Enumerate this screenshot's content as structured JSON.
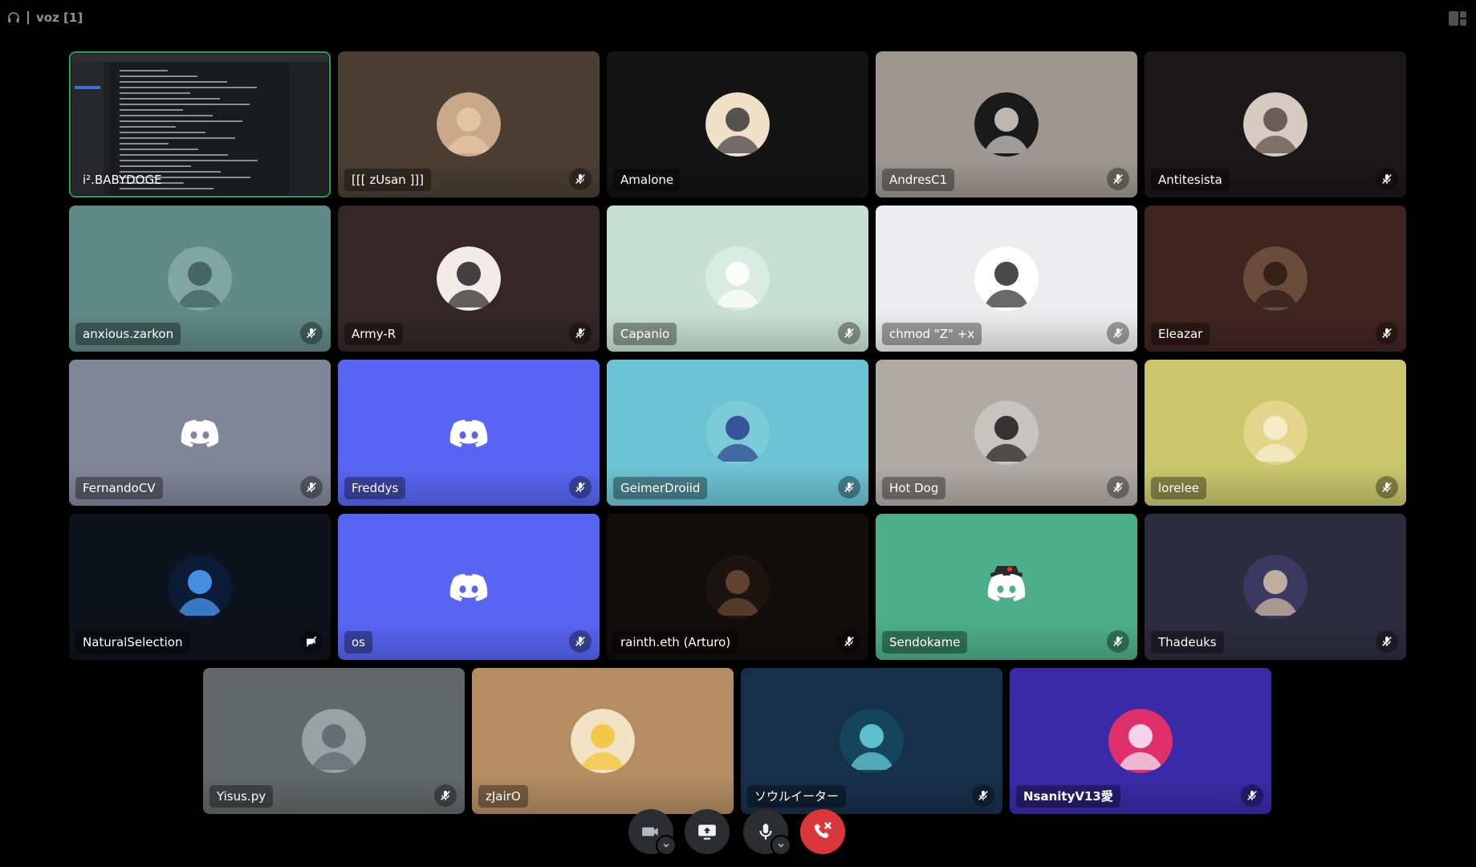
{
  "header": {
    "channel_name": "voz [1]",
    "headset_icon": "headset-icon",
    "layout_icon": "grid-layout-icon"
  },
  "colors": {
    "speaking_ring": "#23a55a",
    "blurple": "#5865f2",
    "danger": "#da373c"
  },
  "participants": [
    {
      "name": "i².BABYDOGE",
      "bg": "#111214",
      "streaming": true,
      "muted": false
    },
    {
      "name": "[[[ zUsan ]]]",
      "bg": "#4b3e32",
      "muted": true,
      "av1": "#c9a98a",
      "av2": "#e8c9a5"
    },
    {
      "name": "Amalone",
      "bg": "#141414",
      "muted": false,
      "av1": "#f1e0c8",
      "av2": "#3a3a3a"
    },
    {
      "name": "AndresC1",
      "bg": "#9e9790",
      "muted": true,
      "av1": "#1a1a1a",
      "av2": "#d9d4cf"
    },
    {
      "name": "Antitesista",
      "bg": "#1c1718",
      "muted": true,
      "av1": "#d6cbc0",
      "av2": "#5a4a45"
    },
    {
      "name": "anxious.zarkon",
      "bg": "#5f8a86",
      "muted": true,
      "av1": "#7fa6a2",
      "av2": "#3c5c58"
    },
    {
      "name": "Army-R",
      "bg": "#352627",
      "muted": true,
      "av1": "#f3ece6",
      "av2": "#222222"
    },
    {
      "name": "Capanio",
      "bg": "#c8dfd3",
      "muted": true,
      "av1": "#d9ece1",
      "av2": "#ffffff"
    },
    {
      "name": "chmod \"Z\" +x",
      "bg": "#ececee",
      "muted": true,
      "av1": "#ffffff",
      "av2": "#2a2a2a"
    },
    {
      "name": "Eleazar",
      "bg": "#40241f",
      "muted": true,
      "av1": "#6b4c3b",
      "av2": "#2a1b15"
    },
    {
      "name": "FernandoCV",
      "bg": "#7f8697",
      "muted": true,
      "discord": true
    },
    {
      "name": "Freddys",
      "bg": "#5865f2",
      "muted": true,
      "discord": true
    },
    {
      "name": "GeimerDroiid",
      "bg": "#6cc3d3",
      "muted": true,
      "av1": "#7ccbd9",
      "av2": "#2b3f8c"
    },
    {
      "name": "Hot Dog",
      "bg": "#b0aaa5",
      "muted": true,
      "av1": "#c7c3bf",
      "av2": "#1b1b1b"
    },
    {
      "name": "lorelee",
      "bg": "#c9c66c",
      "muted": true,
      "av1": "#e3d58c",
      "av2": "#f7f0d0"
    },
    {
      "name": "NaturalSelection",
      "bg": "#0e121a",
      "muted": true,
      "deafened": true,
      "av1": "#0b1a35",
      "av2": "#4da3ff"
    },
    {
      "name": "os",
      "bg": "#5865f2",
      "muted": true,
      "discord": true
    },
    {
      "name": "rainth.eth (Arturo)",
      "bg": "#110d0b",
      "muted": true,
      "av1": "#1d1410",
      "av2": "#6b4a35"
    },
    {
      "name": "Sendokame",
      "bg": "#4daf89",
      "muted": true,
      "discord": true,
      "hat": true
    },
    {
      "name": "Thadeuks",
      "bg": "#2d2c3f",
      "muted": true,
      "av1": "#3a3a60",
      "av2": "#d8c2a8"
    },
    {
      "name": "Yisus.py",
      "bg": "#62686a",
      "muted": true,
      "av1": "#9aa2a5",
      "av2": "#5e6467"
    },
    {
      "name": "zJairO",
      "bg": "#b48d62",
      "muted": false,
      "av1": "#f3e3c6",
      "av2": "#f2c230"
    },
    {
      "name": "ソウルイーター",
      "bg": "#17304a",
      "muted": true,
      "av1": "#15455c",
      "av2": "#6ad3e0"
    },
    {
      "name": "NsanityV13愛",
      "bg": "#3a2aa8",
      "muted": true,
      "av1": "#e0306a",
      "av2": "#f5f0ff"
    }
  ],
  "controls": {
    "camera_icon": "camera-off-icon",
    "share_icon": "screen-share-icon",
    "mic_icon": "microphone-icon",
    "disconnect_icon": "hang-up-icon"
  }
}
